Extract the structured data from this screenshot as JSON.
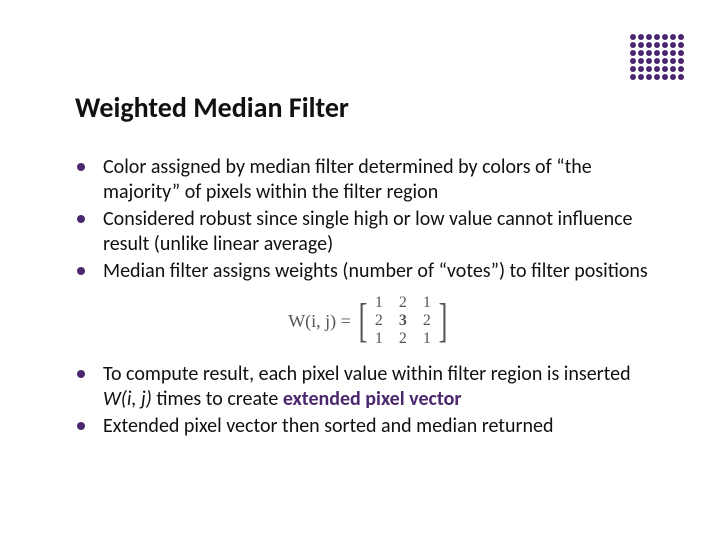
{
  "title": "Weighted Median Filter",
  "bullets_top": [
    "Color assigned by median filter determined by colors of “the majority” of pixels within the filter region",
    "Considered robust since single high or low value cannot influence result (unlike linear average)",
    "Median filter assigns weights (number of “votes”) to filter positions"
  ],
  "matrix": {
    "lhs": "W(i, j)  =",
    "rows": [
      [
        "1",
        "2",
        "1"
      ],
      [
        "2",
        "3",
        "2"
      ],
      [
        "1",
        "2",
        "1"
      ]
    ]
  },
  "bullet4_pre": "To compute result, each pixel value within filter region is inserted ",
  "bullet4_wij": "W(i, j)",
  "bullet4_mid": " times to create ",
  "bullet4_accent": "extended pixel vector",
  "bullet5": "Extended pixel vector then sorted and median returned",
  "decor_dot_count": 42
}
